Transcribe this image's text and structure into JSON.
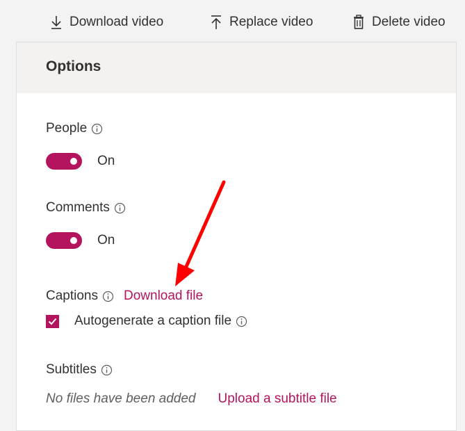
{
  "toolbar": {
    "download": {
      "label": "Download video",
      "icon": "download-icon"
    },
    "replace": {
      "label": "Replace video",
      "icon": "upload-icon"
    },
    "delete": {
      "label": "Delete video",
      "icon": "trash-icon"
    }
  },
  "options": {
    "title": "Options",
    "people": {
      "label": "People",
      "state": "On",
      "enabled": true
    },
    "comments": {
      "label": "Comments",
      "state": "On",
      "enabled": true
    },
    "captions": {
      "label": "Captions",
      "link": "Download file",
      "autogenerate_label": "Autogenerate a caption file",
      "autogenerate_checked": true
    },
    "subtitles": {
      "label": "Subtitles",
      "empty_text": "No files have been added",
      "upload_link": "Upload a subtitle file"
    }
  },
  "colors": {
    "accent": "#b4145e",
    "annotation_arrow": "#ff0000"
  }
}
